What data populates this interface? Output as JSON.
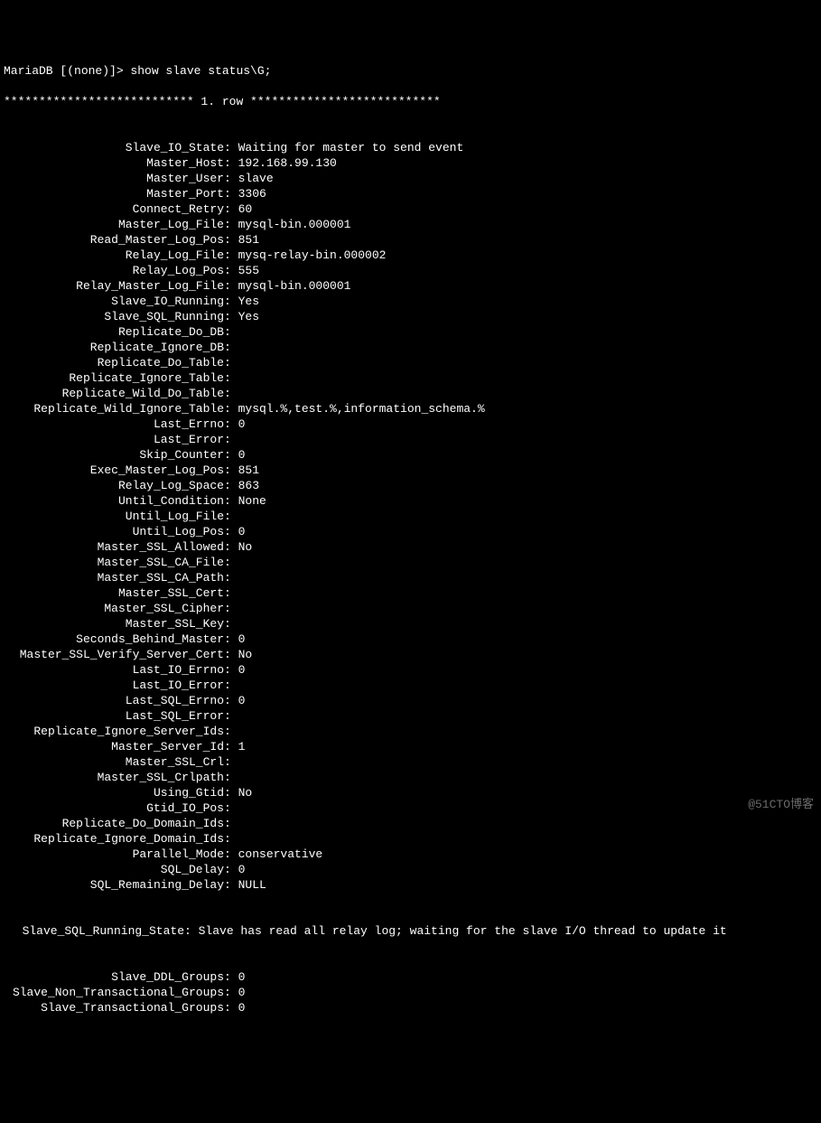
{
  "prompt": "MariaDB [(none)]> show slave status\\G;",
  "separator": "*************************** 1. row ***************************",
  "rows": [
    {
      "label": "Slave_IO_State",
      "value": "Waiting for master to send event"
    },
    {
      "label": "Master_Host",
      "value": "192.168.99.130"
    },
    {
      "label": "Master_User",
      "value": "slave"
    },
    {
      "label": "Master_Port",
      "value": "3306"
    },
    {
      "label": "Connect_Retry",
      "value": "60"
    },
    {
      "label": "Master_Log_File",
      "value": "mysql-bin.000001"
    },
    {
      "label": "Read_Master_Log_Pos",
      "value": "851"
    },
    {
      "label": "Relay_Log_File",
      "value": "mysq-relay-bin.000002"
    },
    {
      "label": "Relay_Log_Pos",
      "value": "555"
    },
    {
      "label": "Relay_Master_Log_File",
      "value": "mysql-bin.000001"
    },
    {
      "label": "Slave_IO_Running",
      "value": "Yes"
    },
    {
      "label": "Slave_SQL_Running",
      "value": "Yes"
    },
    {
      "label": "Replicate_Do_DB",
      "value": ""
    },
    {
      "label": "Replicate_Ignore_DB",
      "value": ""
    },
    {
      "label": "Replicate_Do_Table",
      "value": ""
    },
    {
      "label": "Replicate_Ignore_Table",
      "value": ""
    },
    {
      "label": "Replicate_Wild_Do_Table",
      "value": ""
    },
    {
      "label": "Replicate_Wild_Ignore_Table",
      "value": "mysql.%,test.%,information_schema.%"
    },
    {
      "label": "Last_Errno",
      "value": "0"
    },
    {
      "label": "Last_Error",
      "value": ""
    },
    {
      "label": "Skip_Counter",
      "value": "0"
    },
    {
      "label": "Exec_Master_Log_Pos",
      "value": "851"
    },
    {
      "label": "Relay_Log_Space",
      "value": "863"
    },
    {
      "label": "Until_Condition",
      "value": "None"
    },
    {
      "label": "Until_Log_File",
      "value": ""
    },
    {
      "label": "Until_Log_Pos",
      "value": "0"
    },
    {
      "label": "Master_SSL_Allowed",
      "value": "No"
    },
    {
      "label": "Master_SSL_CA_File",
      "value": ""
    },
    {
      "label": "Master_SSL_CA_Path",
      "value": ""
    },
    {
      "label": "Master_SSL_Cert",
      "value": ""
    },
    {
      "label": "Master_SSL_Cipher",
      "value": ""
    },
    {
      "label": "Master_SSL_Key",
      "value": ""
    },
    {
      "label": "Seconds_Behind_Master",
      "value": "0"
    },
    {
      "label": "Master_SSL_Verify_Server_Cert",
      "value": "No"
    },
    {
      "label": "Last_IO_Errno",
      "value": "0"
    },
    {
      "label": "Last_IO_Error",
      "value": ""
    },
    {
      "label": "Last_SQL_Errno",
      "value": "0"
    },
    {
      "label": "Last_SQL_Error",
      "value": ""
    },
    {
      "label": "Replicate_Ignore_Server_Ids",
      "value": ""
    },
    {
      "label": "Master_Server_Id",
      "value": "1"
    },
    {
      "label": "Master_SSL_Crl",
      "value": ""
    },
    {
      "label": "Master_SSL_Crlpath",
      "value": ""
    },
    {
      "label": "Using_Gtid",
      "value": "No"
    },
    {
      "label": "Gtid_IO_Pos",
      "value": ""
    },
    {
      "label": "Replicate_Do_Domain_Ids",
      "value": ""
    },
    {
      "label": "Replicate_Ignore_Domain_Ids",
      "value": ""
    },
    {
      "label": "Parallel_Mode",
      "value": "conservative"
    },
    {
      "label": "SQL_Delay",
      "value": "0"
    },
    {
      "label": "SQL_Remaining_Delay",
      "value": "NULL"
    }
  ],
  "running_state": {
    "label": "Slave_SQL_Running_State",
    "value": "Slave has read all relay log; waiting for the slave I/O thread to update it"
  },
  "tail_rows": [
    {
      "label": "Slave_DDL_Groups",
      "value": "0"
    },
    {
      "label": "Slave_Non_Transactional_Groups",
      "value": "0"
    },
    {
      "label": "Slave_Transactional_Groups",
      "value": "0"
    }
  ],
  "watermark": "@51CTO博客"
}
